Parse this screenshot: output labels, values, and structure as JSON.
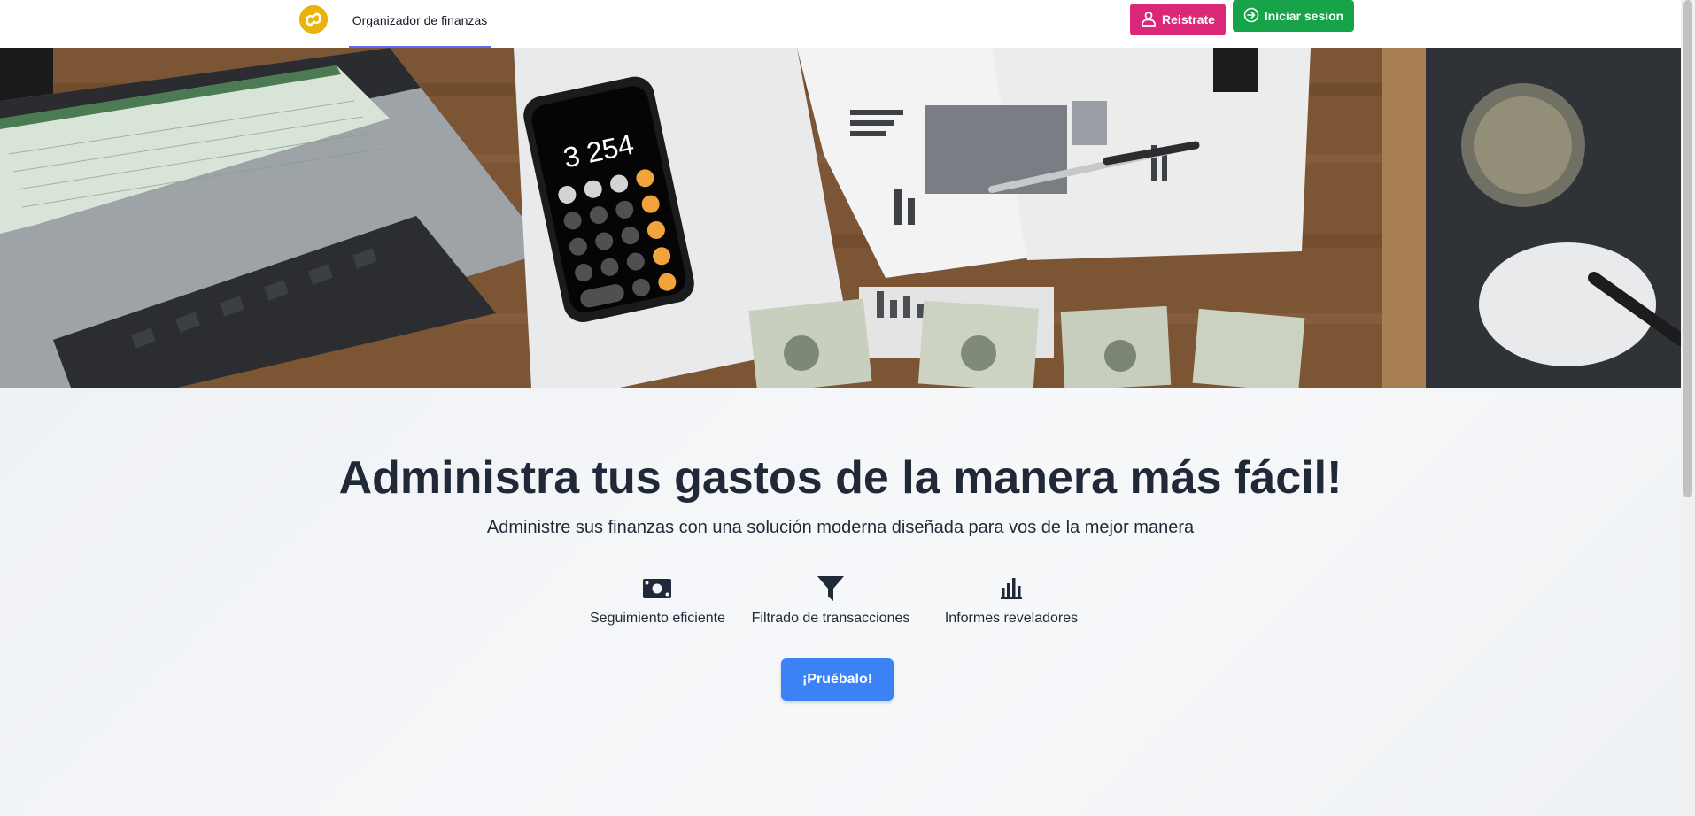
{
  "navbar": {
    "logo_icon": "brand-logo-icon",
    "nav_link": "Organizador de finanzas",
    "register_label": "Reistrate",
    "register_icon": "user-icon",
    "login_label": "Iniciar sesion",
    "login_icon": "login-icon"
  },
  "hero": {
    "image": "desk-finance-photo",
    "calculator_display": "3 254"
  },
  "main": {
    "headline": "Administra tus gastos de la manera más fácil!",
    "subheadline": "Administre sus finanzas con una solución moderna diseñada para vos de la mejor manera",
    "features": [
      {
        "icon": "money-bill-icon",
        "label": "Seguimiento eficiente"
      },
      {
        "icon": "filter-icon",
        "label": "Filtrado de transacciones"
      },
      {
        "icon": "bar-chart-icon",
        "label": "Informes reveladores"
      }
    ],
    "cta_label": "¡Pruébalo!"
  },
  "colors": {
    "brand_yellow": "#eab308",
    "register_pink": "#db2777",
    "login_green": "#16a34a",
    "cta_blue": "#3b82f6",
    "nav_underline": "#6366f1",
    "text_dark": "#1f2937"
  }
}
